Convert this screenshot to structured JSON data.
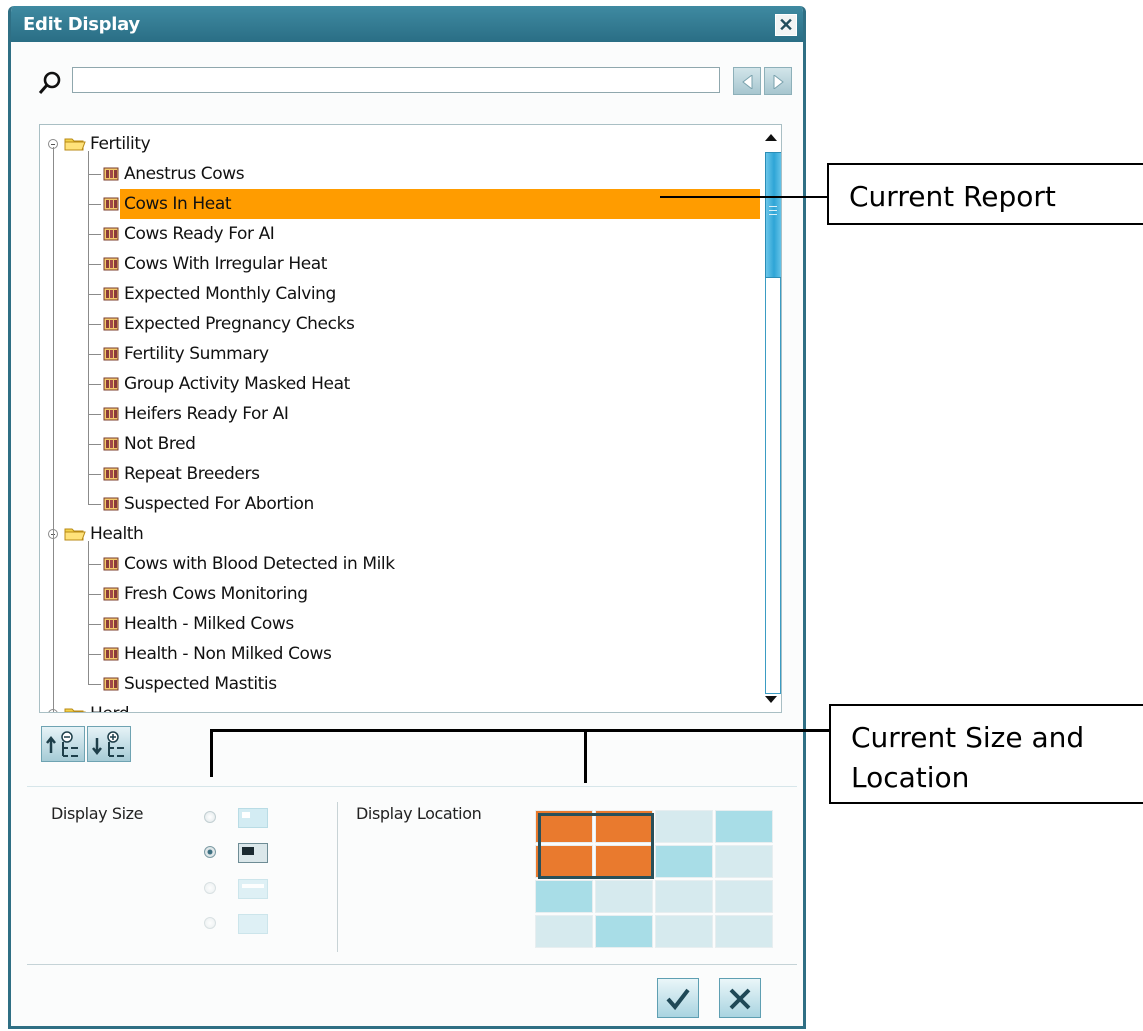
{
  "dialog": {
    "title": "Edit Display",
    "close_icon": "close-icon"
  },
  "search": {
    "value": "",
    "placeholder": ""
  },
  "tree": {
    "groups": [
      {
        "label": "Fertility",
        "items": [
          "Anestrus Cows",
          "Cows In Heat",
          "Cows Ready For AI",
          "Cows With Irregular Heat",
          "Expected Monthly Calving",
          "Expected Pregnancy Checks",
          "Fertility Summary",
          "Group Activity Masked Heat",
          "Heifers Ready For AI",
          "Not Bred",
          "Repeat Breeders",
          "Suspected For Abortion"
        ]
      },
      {
        "label": "Health",
        "items": [
          "Cows with Blood Detected in Milk",
          "Fresh Cows Monitoring",
          "Health - Milked Cows",
          "Health - Non Milked Cows",
          "Suspected Mastitis"
        ]
      },
      {
        "label": "Herd",
        "items": []
      }
    ],
    "selected_item": "Cows In Heat",
    "selected_color": "#ff9c00"
  },
  "display_size": {
    "label": "Display Size",
    "selected_index": 1
  },
  "display_location": {
    "label": "Display Location",
    "selected_color": "#e97a2e",
    "teal_color": "#a8dde7",
    "light_color": "#d6eaee"
  },
  "actions": {
    "ok_icon": "check-icon",
    "cancel_icon": "x-icon"
  },
  "callouts": {
    "report": "Current Report",
    "size_location_line1": "Current Size and",
    "size_location_line2": "Location"
  }
}
